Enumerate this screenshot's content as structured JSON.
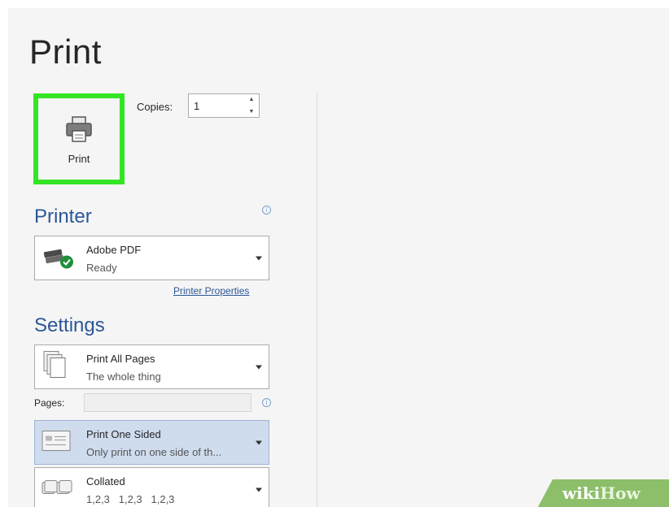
{
  "page": {
    "title": "Print"
  },
  "print_button": {
    "label": "Print",
    "icon": "printer-icon",
    "highlight_color": "#33e524"
  },
  "copies": {
    "label": "Copies:",
    "value": "1"
  },
  "printer": {
    "heading": "Printer",
    "name": "Adobe PDF",
    "status": "Ready",
    "icon": "printer-ready-icon",
    "properties_link": "Printer Properties"
  },
  "settings": {
    "heading": "Settings",
    "pages_label": "Pages:",
    "pages_value": "",
    "items": [
      {
        "title": "Print All Pages",
        "subtitle": "The whole thing",
        "icon": "pages-icon"
      },
      {
        "title": "Print One Sided",
        "subtitle": "Only print on one side of th...",
        "icon": "one-sided-icon"
      },
      {
        "title": "Collated",
        "subtitle": "1,2,3   1,2,3   1,2,3",
        "icon": "collated-icon"
      }
    ]
  },
  "watermark": {
    "part1": "wiki",
    "part2": "How"
  },
  "colors": {
    "accent": "#2b5797",
    "background": "#f5f5f5",
    "selected": "#cfdcee"
  }
}
